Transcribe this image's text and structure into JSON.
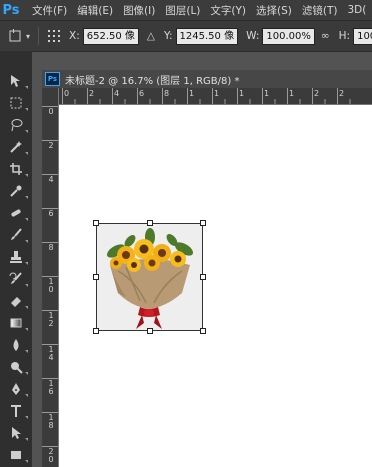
{
  "app": {
    "logo": "Ps"
  },
  "menubar": {
    "items": [
      "文件(F)",
      "编辑(E)",
      "图像(I)",
      "图层(L)",
      "文字(Y)",
      "选择(S)",
      "滤镜(T)",
      "3D("
    ]
  },
  "options": {
    "x_label": "X:",
    "x_value": "652.50 像",
    "delta_symbol": "△",
    "y_label": "Y:",
    "y_value": "1245.50 像",
    "w_label": "W:",
    "w_value": "100.00%",
    "link_symbol": "∞",
    "h_label": "H:",
    "h_value": "100.00"
  },
  "document": {
    "badge": "Ps",
    "title": "未标题-2 @ 16.7% (图层 1, RGB/8) *"
  },
  "ruler": {
    "h_labels": [
      "0",
      "2",
      "4",
      "6",
      "8",
      "1",
      "1",
      "1",
      "1",
      "1",
      "2",
      "2"
    ],
    "v_labels": [
      "0",
      "2",
      "4",
      "6",
      "8",
      "1 0",
      "1 2",
      "1 4",
      "1 6",
      "1 8",
      "2 0"
    ]
  },
  "tools": [
    "move-tool",
    "marquee-tool",
    "lasso-tool",
    "magic-wand-tool",
    "crop-tool",
    "eyedropper-tool",
    "healing-brush-tool",
    "brush-tool",
    "clone-stamp-tool",
    "history-brush-tool",
    "eraser-tool",
    "gradient-tool",
    "blur-tool",
    "dodge-tool",
    "pen-tool",
    "type-tool",
    "path-selection-tool",
    "rectangle-tool"
  ],
  "colors": {
    "bg": "#535353",
    "menubar": "#3c3c3c",
    "toolbox": "#2f2f2f",
    "ps_blue": "#31a8ff",
    "canvas": "#ffffff"
  }
}
